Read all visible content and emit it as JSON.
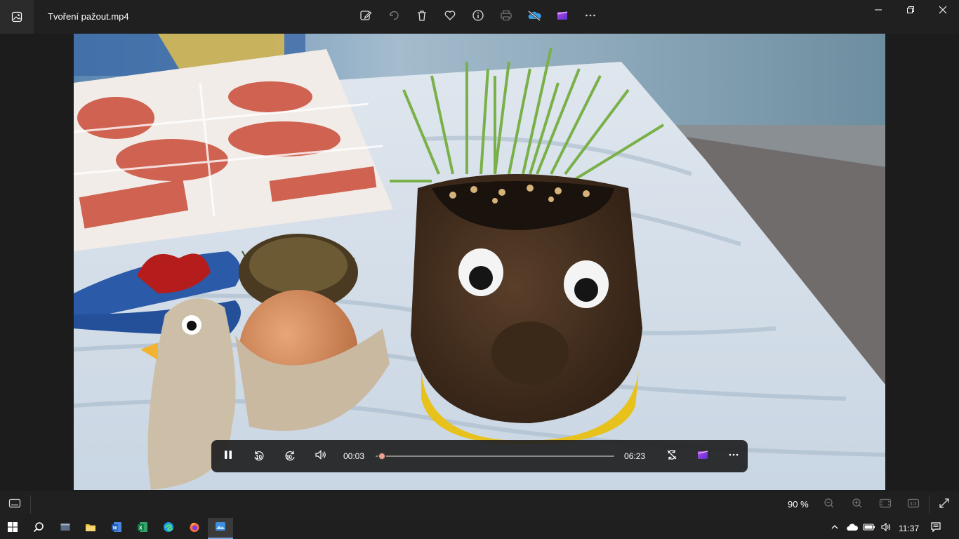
{
  "window": {
    "title": "Tvoření pažout.mp4",
    "app_icon": "photos-app-icon"
  },
  "toolbar": {
    "items": [
      {
        "icon": "edit-image-icon",
        "label": "Edit image"
      },
      {
        "icon": "rotate-icon",
        "label": "Rotate"
      },
      {
        "icon": "delete-icon",
        "label": "Delete"
      },
      {
        "icon": "favorite-icon",
        "label": "Add to favorites"
      },
      {
        "icon": "info-icon",
        "label": "File information"
      },
      {
        "icon": "print-icon",
        "label": "Print"
      },
      {
        "icon": "onedrive-icon",
        "label": "OneDrive"
      },
      {
        "icon": "clipchamp-icon",
        "label": "Edit with Clipchamp"
      },
      {
        "icon": "more-icon",
        "label": "More"
      }
    ]
  },
  "player": {
    "current_time": "00:03",
    "total_time": "06:23",
    "progress": 0.008,
    "skip_back": "10",
    "skip_forward": "30"
  },
  "statusbar": {
    "zoom": "90 %"
  },
  "taskbar": {
    "time": "11:37"
  },
  "colors": {
    "accent": "#f0a38a",
    "background": "#202020"
  }
}
